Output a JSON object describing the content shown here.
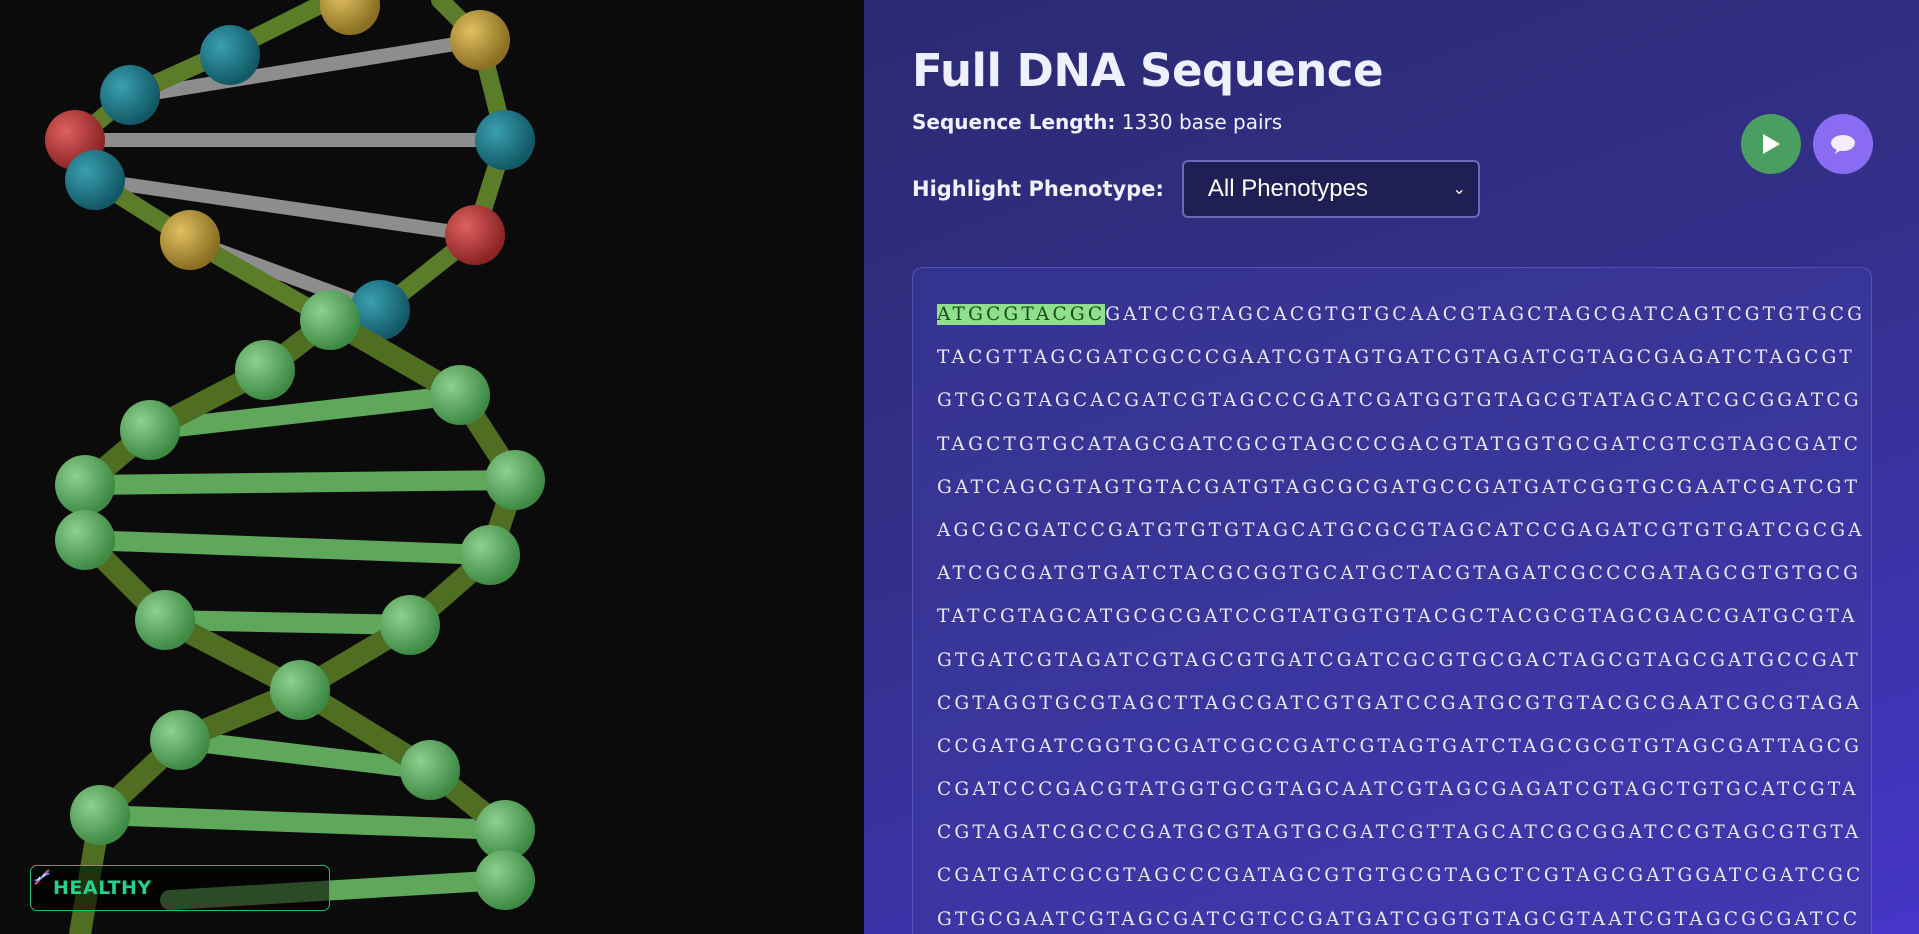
{
  "viewer": {
    "status_label": "HEALTHY"
  },
  "panel": {
    "title": "Full DNA Sequence",
    "length_key": "Sequence Length:",
    "length_value": " 1330 base pairs",
    "phenotype_label": "Highlight Phenotype:",
    "phenotype_selected": "All Phenotypes",
    "highlight_text": "ATGCGTACGC",
    "first_line_rest": "GATCCGTAGCACGTGTGCAACGTAGCTAGCGATCAGTCGTGTGCG",
    "lines": [
      "TACGTTAGCGATCGCCCGAATCGTAGTGATCGTAGATCGTAGCGAGATCTAGCGT",
      "GTGCGTAGCACGATCGTAGCCCGATCGATGGTGTAGCGTATAGCATCGCGGATCG",
      "TAGCTGTGCATAGCGATCGCGTAGCCCGACGTATGGTGCGATCGTCGTAGCGATC",
      "GATCAGCGTAGTGTACGATGTAGCGCGATGCCGATGATCGGTGCGAATCGATCGT",
      "AGCGCGATCCGATGTGTGTAGCATGCGCGTAGCATCCGAGATCGTGTGATCGCGA",
      "ATCGCGATGTGATCTACGCGGTGCATGCTACGTAGATCGCCCGATAGCGTGTGCG",
      "TATCGTAGCATGCGCGATCCGTATGGTGTACGCTACGCGTAGCGACCGATGCGTA",
      "GTGATCGTAGATCGTAGCGTGATCGATCGCGTGCGACTAGCGTAGCGATGCCGAT",
      "CGTAGGTGCGTAGCTTAGCGATCGTGATCCGATGCGTGTACGCGAATCGCGTAGA",
      "CCGATGATCGGTGCGATCGCCGATCGTAGTGATCTAGCGCGTGTAGCGATTAGCG",
      "CGATCCCGACGTATGGTGCGTAGCAATCGTAGCGAGATCGTAGCTGTGCATCGTA",
      "CGTAGATCGCCCGATGCGTAGTGCGATCGTTAGCATCGCGGATCCGTAGCGTGTA",
      "CGATGATCGCGTAGCCCGATAGCGTGTGCGTAGCTCGTAGCGATGGATCGATCGC",
      "GTGCGAATCGTAGCGATCGTCCGATGATCGGTGTAGCGTAATCGTAGCGCGATCC"
    ]
  },
  "colors": {
    "panel_bg": "#33308a",
    "highlight": "#8ee08a",
    "healthy": "#1fd58b",
    "play_button": "#4b9e62",
    "chat_button": "#8a6cf2"
  },
  "icons": {
    "play": "play-icon",
    "chat": "chat-bubble-icon",
    "dna": "dna-icon"
  }
}
